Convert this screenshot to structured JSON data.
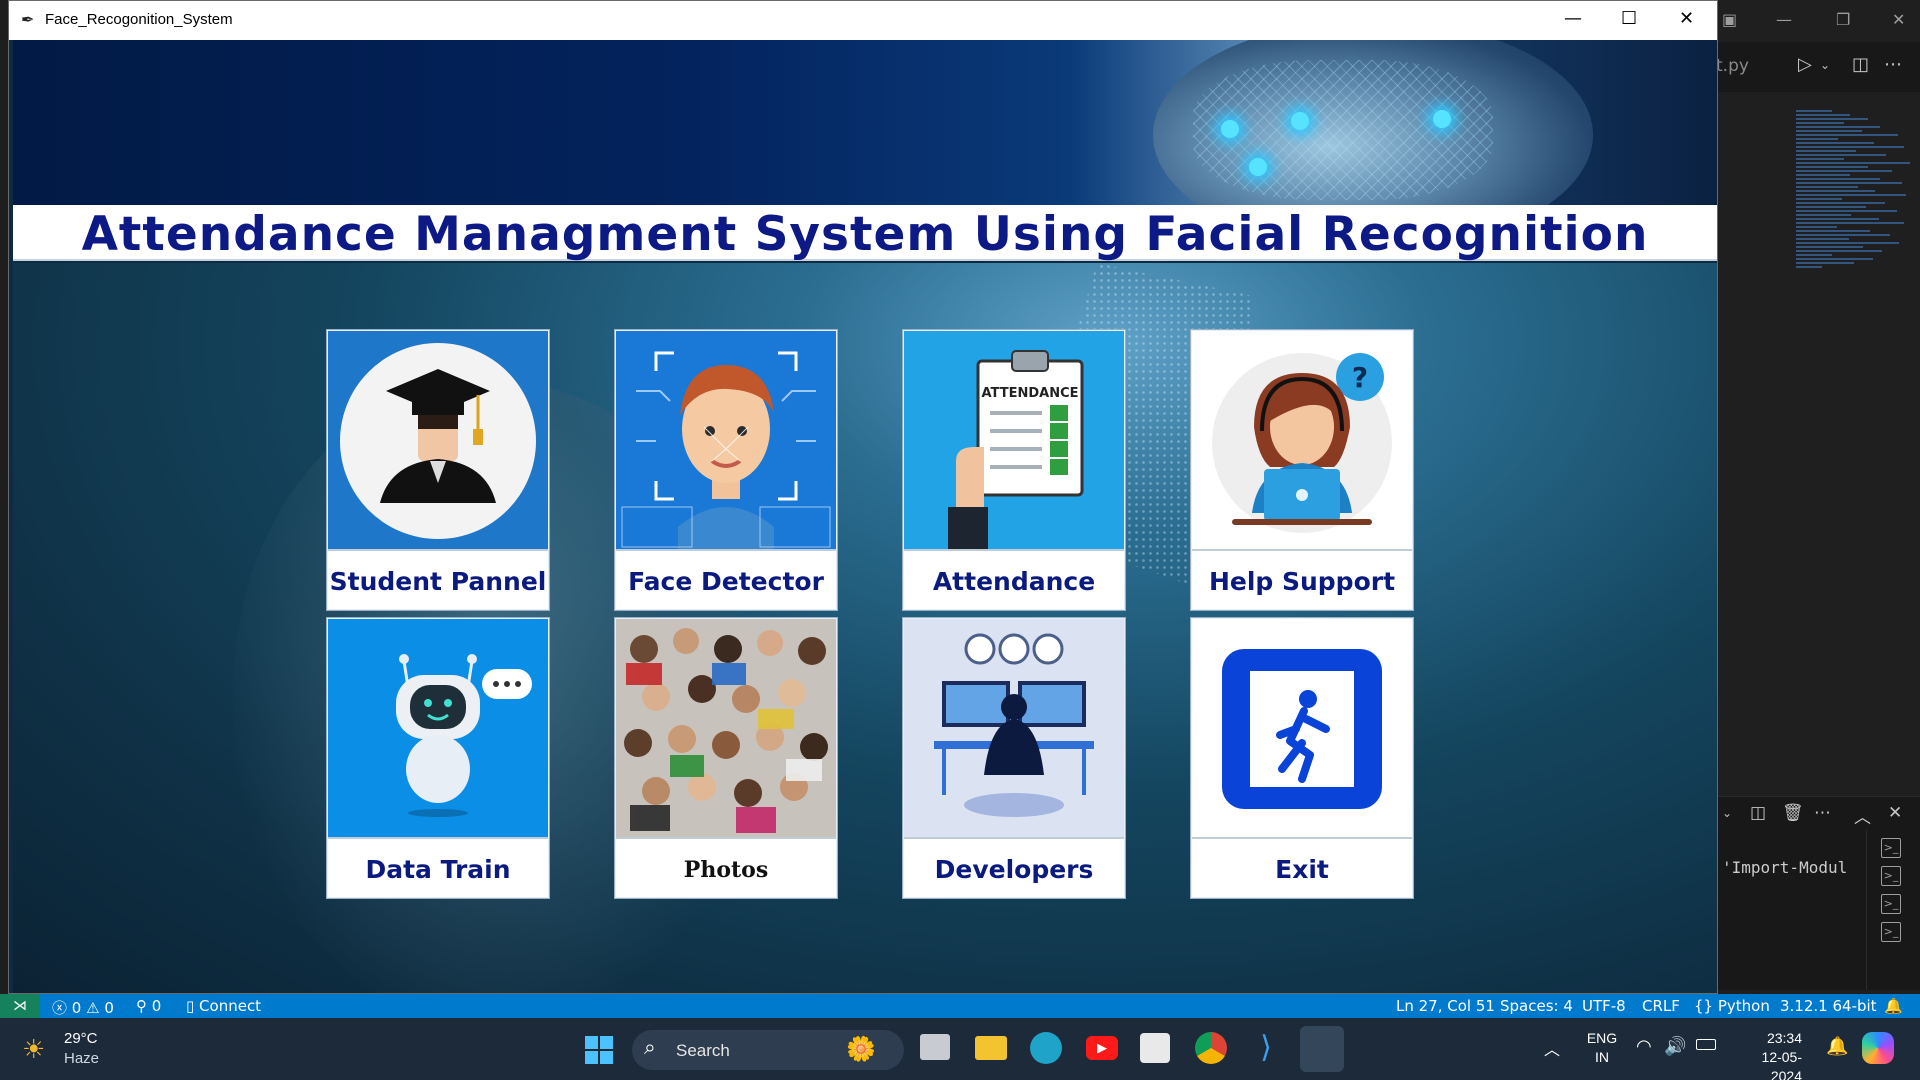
{
  "app": {
    "window_title": "Face_Recogonition_System",
    "headline": "Attendance Managment System Using Facial Recognition",
    "tiles_row1": [
      {
        "label": "Student Pannel"
      },
      {
        "label": "Face Detector"
      },
      {
        "label": "Attendance"
      },
      {
        "label": "Help Support"
      }
    ],
    "tiles_row2": [
      {
        "label": "Data Train"
      },
      {
        "label": "Photos"
      },
      {
        "label": "Developers"
      },
      {
        "label": "Exit"
      }
    ],
    "attendance_clipboard_text": "ATTENDANCE",
    "help_badge_text": "?"
  },
  "vscode": {
    "tab_fragment": "t.py",
    "terminal_text": "'Import-Modul"
  },
  "statusbar": {
    "errors": "0",
    "warnings": "0",
    "ports": "0",
    "connect": "Connect",
    "position": "Ln 27, Col 51",
    "spaces": "Spaces: 4",
    "encoding": "UTF-8",
    "eol": "CRLF",
    "language": "Python",
    "interpreter": "3.12.1 64-bit"
  },
  "taskbar": {
    "weather_temp": "29°C",
    "weather_desc": "Haze",
    "search_placeholder": "Search",
    "lang_top": "ENG",
    "lang_bottom": "IN",
    "time": "23:34",
    "date": "12-05-2024"
  },
  "colors": {
    "headline_text": "#0d1a86",
    "statusbar": "#007acc",
    "taskbar": "#1c2a3a",
    "tile_label": "#0b1a7e"
  }
}
